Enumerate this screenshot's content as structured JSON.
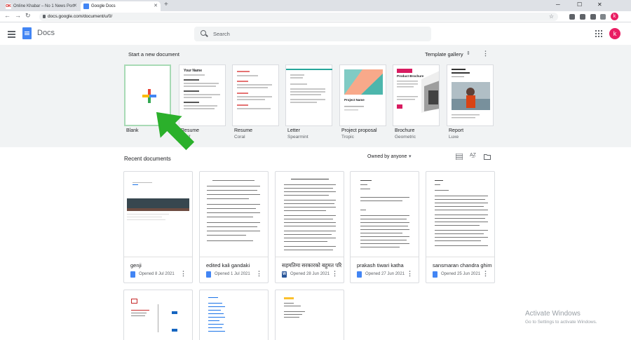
{
  "browser": {
    "tabs": [
      {
        "title": "Online Khabar – No 1 News Port"
      },
      {
        "title": "Google Docs"
      }
    ],
    "url": "docs.google.com/document/u/0/",
    "profile_initial": "k"
  },
  "header": {
    "app_name": "Docs",
    "search_placeholder": "Search",
    "avatar_initial": "k"
  },
  "gallery": {
    "start_title": "Start a new document",
    "gallery_label": "Template gallery",
    "templates": [
      {
        "name": "Blank",
        "sub": ""
      },
      {
        "name": "Resume",
        "sub": "Serif"
      },
      {
        "name": "Resume",
        "sub": "Coral"
      },
      {
        "name": "Letter",
        "sub": "Spearmint"
      },
      {
        "name": "Project proposal",
        "sub": "Tropic"
      },
      {
        "name": "Brochure",
        "sub": "Geometric"
      },
      {
        "name": "Report",
        "sub": "Luxe"
      }
    ],
    "resume_preview_name": "Your Name",
    "proposal_preview_name": "Project Name",
    "brochure_preview_name": "Product Brochure"
  },
  "recent": {
    "title": "Recent documents",
    "owner_filter": "Owned by anyone",
    "documents": [
      {
        "title": "genji",
        "opened": "Opened 8 Jul 2021",
        "type": "docs"
      },
      {
        "title": "edited kali gandaki",
        "opened": "Opened 1 Jul 2021",
        "type": "docs"
      },
      {
        "title": "सहमतिमा सरकारको बहुमत परिक्षे...",
        "opened": "Opened 28 Jun 2021",
        "type": "word"
      },
      {
        "title": "prakash tiwari katha",
        "opened": "Opened 27 Jun 2021",
        "type": "docs"
      },
      {
        "title": "sansmaran chandra ghimi...",
        "opened": "Opened 25 Jun 2021",
        "type": "docs"
      }
    ],
    "word_icon_letter": "W"
  },
  "os_watermark": {
    "title": "Activate Windows",
    "subtitle": "Go to Settings to activate Windows."
  },
  "colors": {
    "accent": "#4285f4",
    "gallery_bg": "#f1f3f4",
    "blank_border": "#a8dab5",
    "arrow": "#2bb02b",
    "avatar": "#e91e63"
  }
}
